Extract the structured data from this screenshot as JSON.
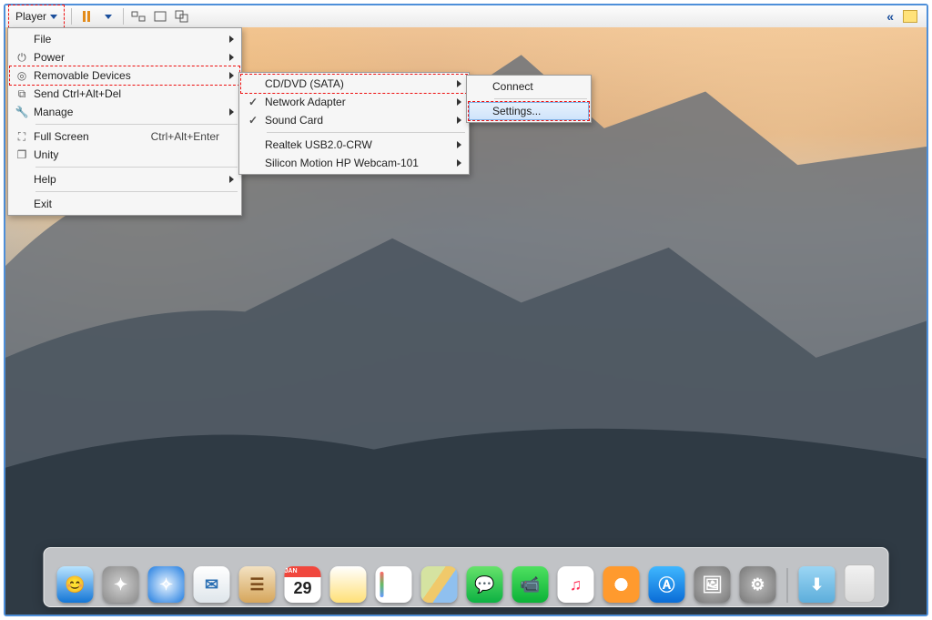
{
  "toolbar": {
    "player_label": "Player",
    "pause_tip": "Pause",
    "power_tip": "Power",
    "send_cad_tip": "Send Ctrl+Alt+Del",
    "fullscreen_tip": "Full Screen",
    "unity_tip": "Unity"
  },
  "menu": {
    "items": [
      {
        "label": "File",
        "icon": "",
        "submenu": true
      },
      {
        "label": "Power",
        "icon": "power",
        "submenu": true
      },
      {
        "label": "Removable Devices",
        "icon": "disc",
        "submenu": true,
        "highlight": true
      },
      {
        "label": "Send Ctrl+Alt+Del",
        "icon": "cad",
        "submenu": false
      },
      {
        "label": "Manage",
        "icon": "wrench",
        "submenu": true
      },
      {
        "sep": true
      },
      {
        "label": "Full Screen",
        "icon": "fullscreen",
        "shortcut": "Ctrl+Alt+Enter"
      },
      {
        "label": "Unity",
        "icon": "unity"
      },
      {
        "sep": true
      },
      {
        "label": "Help",
        "submenu": true
      },
      {
        "sep": true
      },
      {
        "label": "Exit"
      }
    ]
  },
  "submenu_rd": {
    "items": [
      {
        "label": "CD/DVD (SATA)",
        "submenu": true,
        "highlight": true
      },
      {
        "label": "Network Adapter",
        "submenu": true,
        "checked": true
      },
      {
        "label": "Sound Card",
        "submenu": true,
        "checked": true
      },
      {
        "sep": true
      },
      {
        "label": "Realtek USB2.0-CRW",
        "submenu": true
      },
      {
        "label": "Silicon Motion HP Webcam-101",
        "submenu": true
      }
    ]
  },
  "submenu_cd": {
    "items": [
      {
        "label": "Connect"
      },
      {
        "sep": true
      },
      {
        "label": "Settings...",
        "hover": true
      }
    ]
  },
  "dock": {
    "calendar_month": "JAN",
    "calendar_day": "29",
    "apps": [
      "finder",
      "launchpad",
      "safari",
      "mail",
      "contacts",
      "calendar",
      "notes",
      "reminders",
      "maps",
      "messages",
      "facetime",
      "itunes",
      "ibooks",
      "appstore",
      "preview",
      "system-preferences",
      "downloads",
      "trash"
    ]
  }
}
